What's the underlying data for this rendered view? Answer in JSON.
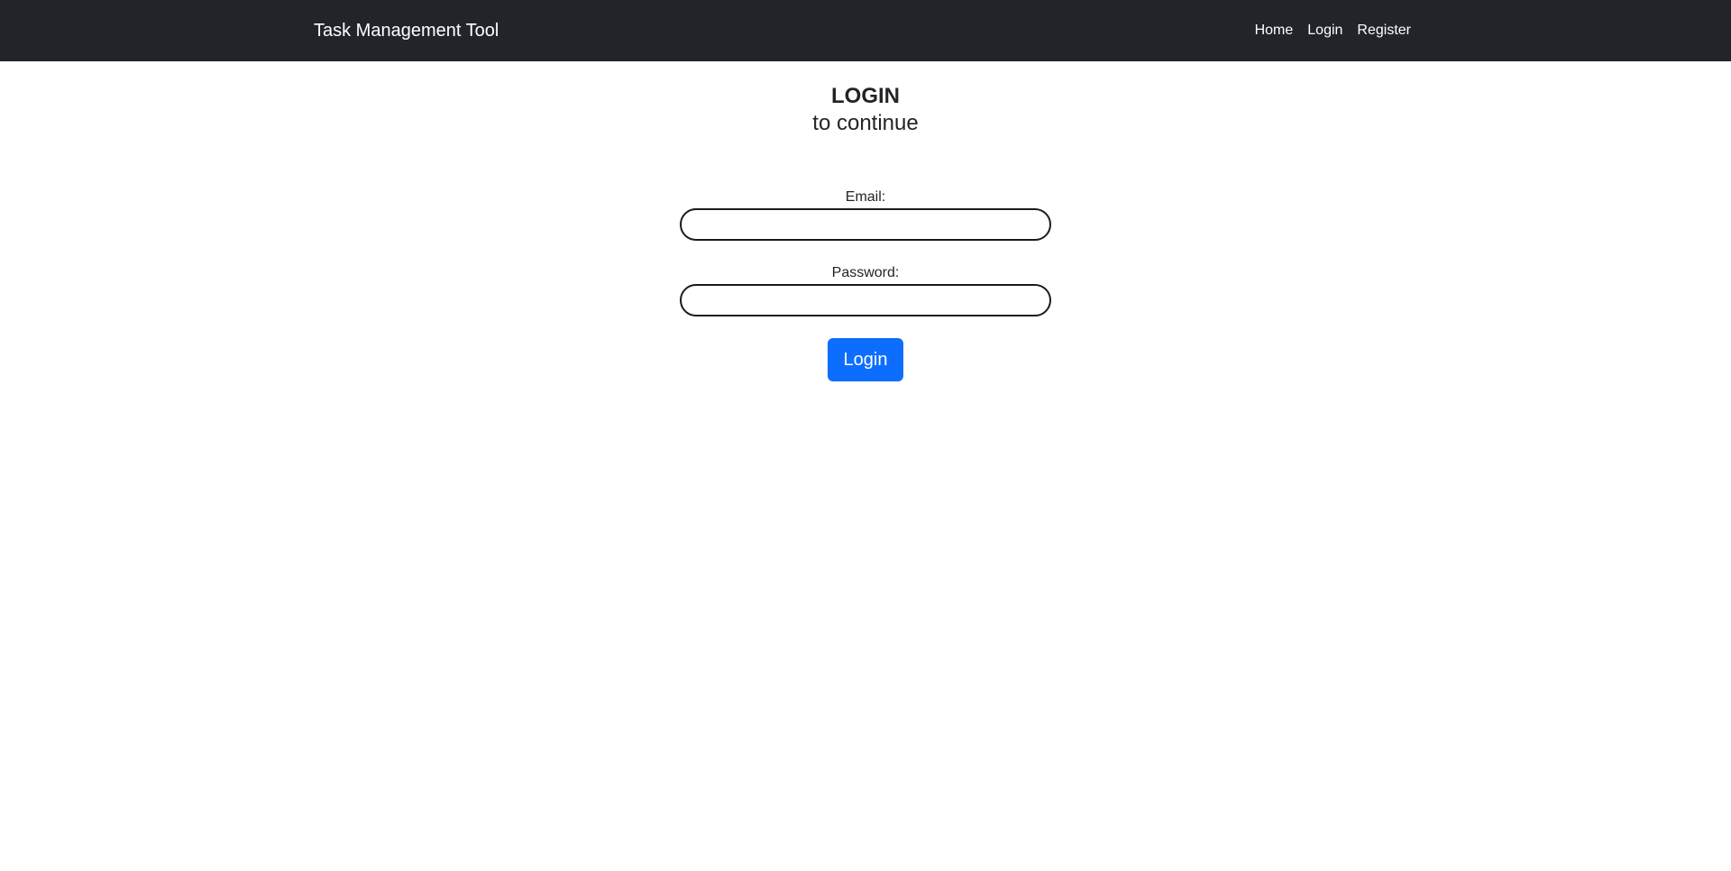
{
  "navbar": {
    "brand": "Task Management Tool",
    "links": [
      "Home",
      "Login",
      "Register"
    ]
  },
  "heading": {
    "title": "LOGIN",
    "subtitle": "to continue"
  },
  "form": {
    "email_label": "Email:",
    "email_value": "",
    "password_label": "Password:",
    "password_value": "",
    "submit_label": "Login"
  },
  "colors": {
    "navbar_bg": "#212529",
    "primary_button": "#0d6efd",
    "text": "#212529"
  }
}
